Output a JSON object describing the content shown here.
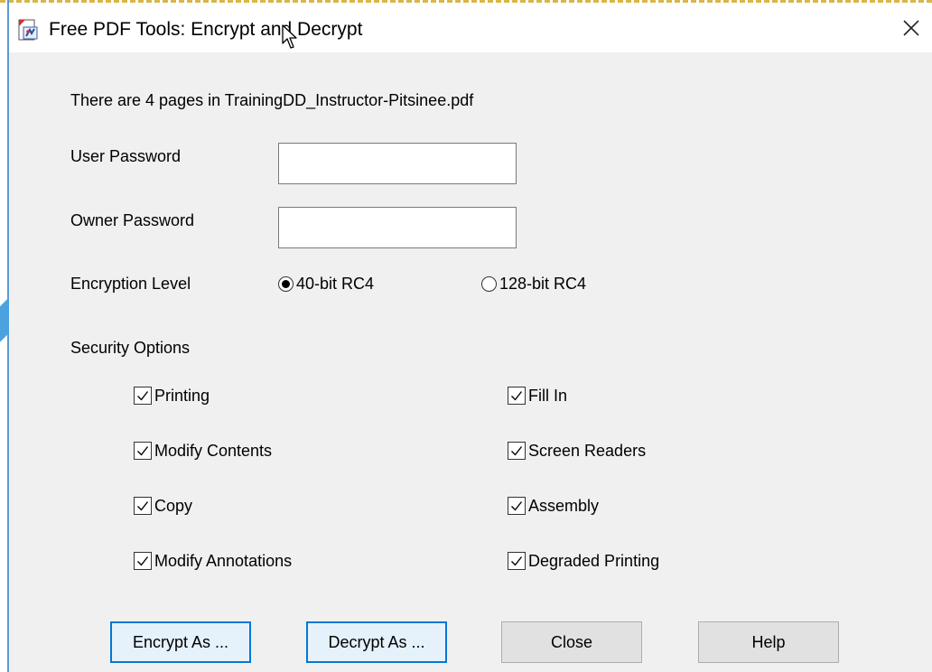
{
  "window": {
    "title": "Free PDF Tools:  Encrypt and Decrypt",
    "close_glyph": "✕"
  },
  "info": {
    "page_count_text": "There are 4 pages in TrainingDD_Instructor-Pitsinee.pdf"
  },
  "fields": {
    "user_password": {
      "label": "User Password",
      "value": ""
    },
    "owner_password": {
      "label": "Owner Password",
      "value": ""
    }
  },
  "encryption": {
    "label": "Encryption Level",
    "options": [
      {
        "label": "40-bit RC4",
        "selected": true
      },
      {
        "label": "128-bit RC4",
        "selected": false
      }
    ]
  },
  "security": {
    "label": "Security Options",
    "options": [
      {
        "label": "Printing",
        "checked": true
      },
      {
        "label": "Fill In",
        "checked": true
      },
      {
        "label": "Modify Contents",
        "checked": true
      },
      {
        "label": "Screen Readers",
        "checked": true
      },
      {
        "label": "Copy",
        "checked": true
      },
      {
        "label": "Assembly",
        "checked": true
      },
      {
        "label": "Modify Annotations",
        "checked": true
      },
      {
        "label": "Degraded Printing",
        "checked": true
      }
    ]
  },
  "buttons": {
    "encrypt": "Encrypt As ...",
    "decrypt": "Decrypt As ...",
    "close": "Close",
    "help": "Help"
  },
  "icons": {
    "app": "pdf-tool-icon",
    "cursor": "mouse-pointer-icon",
    "close": "close-icon",
    "check": "checkmark-icon"
  },
  "colors": {
    "dialog_bg": "#f0f0f0",
    "titlebar_bg": "#ffffff",
    "focus_border": "#0078d7",
    "button_bg": "#e1e1e1",
    "desktop_accent": "#4aa3df",
    "dashed_border": "#d8b64a"
  }
}
